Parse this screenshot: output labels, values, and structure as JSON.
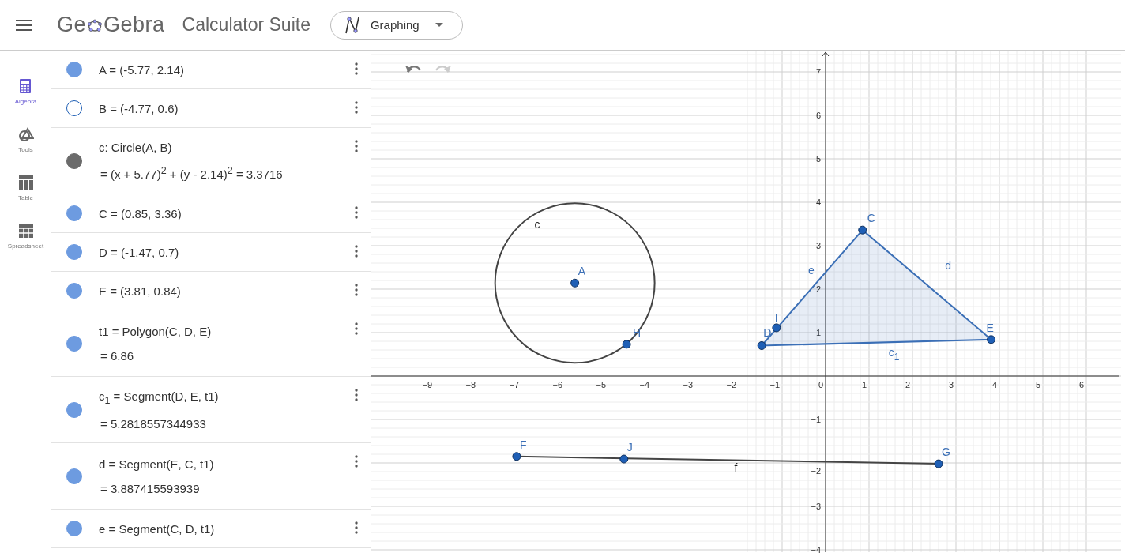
{
  "header": {
    "logo_left": "Ge",
    "logo_right": "Gebra",
    "title": "Calculator Suite",
    "app_switcher": {
      "label": "Graphing"
    }
  },
  "nav": [
    {
      "label": "Algebra",
      "kind": "algebra",
      "selected": true
    },
    {
      "label": "Tools",
      "kind": "tools",
      "selected": false
    },
    {
      "label": "Table",
      "kind": "table",
      "selected": false
    },
    {
      "label": "Spreadsheet",
      "kind": "spreadsheet",
      "selected": false
    }
  ],
  "algebra": [
    {
      "text": "A = (-5.77, 2.14)",
      "visible": true,
      "color": "#6d9be0"
    },
    {
      "text": "B = (-4.77, 0.6)",
      "visible": false,
      "color": "#1f5fb5"
    },
    {
      "text": "c: Circle(A, B)",
      "value": "= (x + 5.77)$^{2}$ + (y - 2.14)$^{2}$ = 3.3716",
      "visible": true,
      "color": "#6b6b6b"
    },
    {
      "text": "C = (0.85, 3.36)",
      "visible": true,
      "color": "#6d9be0"
    },
    {
      "text": "D = (-1.47, 0.7)",
      "visible": true,
      "color": "#6d9be0"
    },
    {
      "text": "E = (3.81, 0.84)",
      "visible": true,
      "color": "#6d9be0"
    },
    {
      "text": "t1 = Polygon(C, D, E)",
      "value": "= 6.86",
      "visible": true,
      "color": "#6d9be0"
    },
    {
      "text": "c$_{1}$ = Segment(D, E, t1)",
      "value": "= 5.2818557344933",
      "visible": true,
      "color": "#6d9be0"
    },
    {
      "text": "d = Segment(E, C, t1)",
      "value": "= 3.887415593939",
      "visible": true,
      "color": "#6d9be0"
    },
    {
      "text": "e = Segment(C, D, t1)",
      "visible": true,
      "color": "#6d9be0"
    }
  ],
  "graphics": {
    "x_ticks": [
      "−9",
      "−8",
      "−7",
      "−6",
      "−5",
      "−4",
      "−3",
      "−2",
      "−1",
      "0",
      "1",
      "2",
      "3",
      "4",
      "5",
      "6"
    ],
    "y_ticks": [
      "7",
      "6",
      "5",
      "4",
      "3",
      "2",
      "1",
      "−1",
      "−2",
      "−3",
      "−4"
    ],
    "points": [
      {
        "label": "A"
      },
      {
        "label": "H"
      },
      {
        "label": "C"
      },
      {
        "label": "D"
      },
      {
        "label": "E"
      },
      {
        "label": "I"
      },
      {
        "label": "F"
      },
      {
        "label": "J"
      },
      {
        "label": "G"
      }
    ],
    "object_labels": [
      {
        "label": "c",
        "color": "#222222"
      },
      {
        "label": "e",
        "color": "#3b6fb6"
      },
      {
        "label": "d",
        "color": "#3b6fb6"
      },
      {
        "label": "c",
        "subscript": "1",
        "color": "#3b6fb6"
      },
      {
        "label": "f",
        "color": "#222222"
      }
    ]
  }
}
